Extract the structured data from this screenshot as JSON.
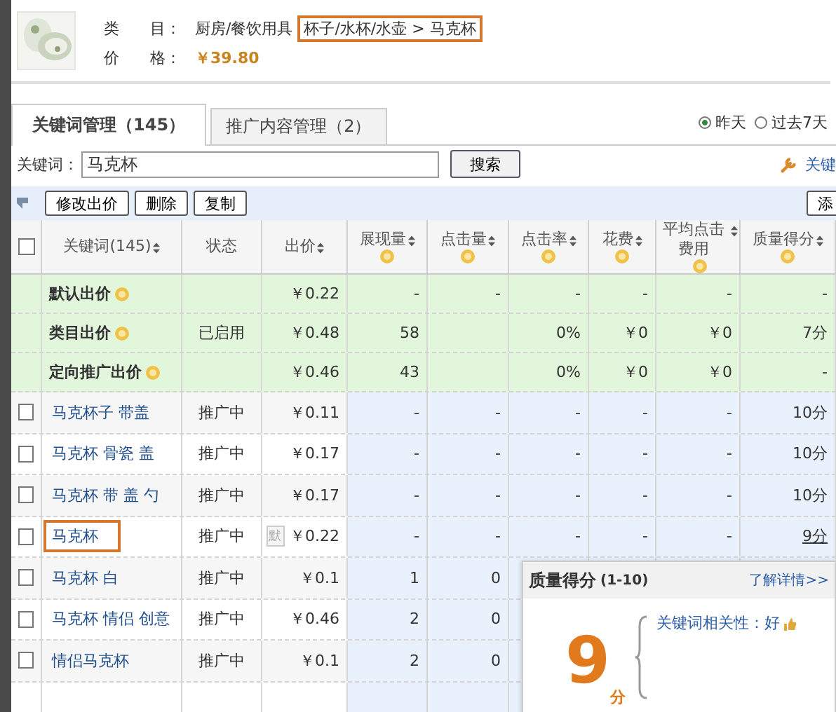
{
  "product": {
    "category_label": "类　　目：",
    "category": "厨房/餐饮用具",
    "category_highlight": "杯子/水杯/水壶 > 马克杯",
    "price_label": "价　　格：",
    "price": "￥39.80"
  },
  "tabs": [
    {
      "label": "关键词管理（145）",
      "selected": true
    },
    {
      "label": "推广内容管理（2）",
      "selected": false
    }
  ],
  "range": [
    {
      "label": "昨天",
      "selected": true
    },
    {
      "label": "过去7天",
      "selected": false
    }
  ],
  "tool_link": "关键",
  "search": {
    "label": "关键词：",
    "value": "马克杯",
    "button": "搜索"
  },
  "toolbar": [
    "修改出价",
    "删除",
    "复制",
    "添"
  ],
  "select_all_checked": false,
  "columns": [
    {
      "label": "关键词(145)",
      "sort": true,
      "help": false
    },
    {
      "label": "状态",
      "sort": false,
      "help": false
    },
    {
      "label": "出价",
      "sort": true,
      "help": false
    },
    {
      "label": "展现量",
      "sort": true,
      "help": true
    },
    {
      "label": "点击量",
      "sort": true,
      "help": true
    },
    {
      "label": "点击率",
      "sort": true,
      "help": true
    },
    {
      "label": "花费",
      "sort": true,
      "help": true
    },
    {
      "label": "平均点击费用",
      "sort": true,
      "help": true
    },
    {
      "label": "质量得分",
      "sort": true,
      "help": true
    }
  ],
  "rows": [
    {
      "kind": "summary",
      "keyword": "默认出价",
      "status": "",
      "bid": "￥0.22",
      "cells": [
        "-",
        "-",
        "-",
        "-",
        "-",
        "-"
      ],
      "popup_open": false
    },
    {
      "kind": "summary",
      "keyword": "类目出价",
      "status": "已启用",
      "bid": "￥0.48",
      "cells": [
        "58",
        "",
        "0%",
        "￥0",
        "￥0",
        "7分"
      ],
      "popup_open": false
    },
    {
      "kind": "summary",
      "keyword": "定向推广出价",
      "status": "",
      "bid": "￥0.46",
      "cells": [
        "43",
        "",
        "0%",
        "￥0",
        "￥0",
        "-"
      ],
      "popup_open": false
    },
    {
      "kind": "keyword",
      "checked": false,
      "highlighted": false,
      "keyword": "马克杯子 带盖",
      "status": "推广中",
      "bid": "￥0.11",
      "cells": [
        "-",
        "-",
        "-",
        "-",
        "-",
        "10分"
      ],
      "popup_open": false
    },
    {
      "kind": "keyword",
      "checked": false,
      "highlighted": false,
      "keyword": "马克杯 骨瓷 盖",
      "status": "推广中",
      "bid": "￥0.17",
      "cells": [
        "-",
        "-",
        "-",
        "-",
        "-",
        "10分"
      ],
      "popup_open": false
    },
    {
      "kind": "keyword",
      "checked": false,
      "highlighted": false,
      "keyword": "马克杯 带 盖 勺",
      "status": "推广中",
      "bid": "￥0.17",
      "cells": [
        "-",
        "-",
        "-",
        "-",
        "-",
        "10分"
      ],
      "popup_open": false
    },
    {
      "kind": "keyword",
      "checked": false,
      "highlighted": true,
      "default_tag": "默",
      "keyword": "马克杯",
      "status": "推广中",
      "bid": "￥0.22",
      "cells": [
        "-",
        "-",
        "-",
        "-",
        "-",
        "9分"
      ],
      "popup_open": true
    },
    {
      "kind": "keyword",
      "checked": false,
      "highlighted": false,
      "keyword": "马克杯 白",
      "status": "推广中",
      "bid": "￥0.1",
      "cells": [
        "1",
        "0"
      ]
    },
    {
      "kind": "keyword",
      "checked": false,
      "highlighted": false,
      "keyword": "马克杯 情侣 创意",
      "status": "推广中",
      "bid": "￥0.46",
      "cells": [
        "2",
        "0"
      ]
    },
    {
      "kind": "keyword",
      "checked": false,
      "highlighted": false,
      "keyword": "情侣马克杯",
      "status": "推广中",
      "bid": "￥0.1",
      "cells": [
        "2",
        "0"
      ]
    }
  ],
  "popup": {
    "title": "质量得分",
    "range": "(1-10)",
    "link": "了解详情>>",
    "score": "9",
    "unit": "分",
    "items": [
      "关键词相关性：好"
    ]
  }
}
